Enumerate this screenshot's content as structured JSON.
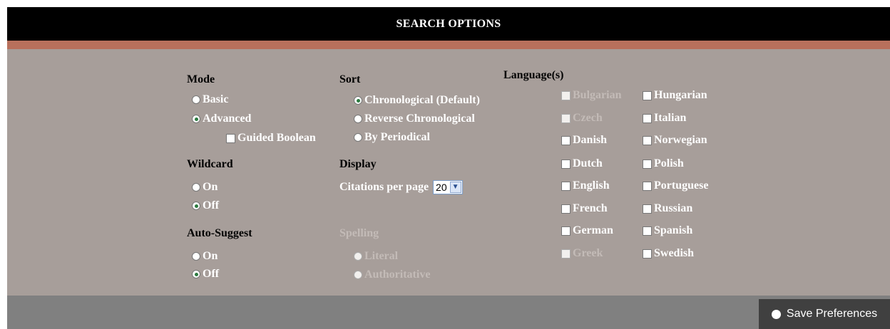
{
  "header": {
    "title": "SEARCH OPTIONS"
  },
  "mode": {
    "label": "Mode",
    "options": [
      {
        "label": "Basic",
        "selected": false
      },
      {
        "label": "Advanced",
        "selected": true
      }
    ],
    "guided_boolean": "Guided Boolean"
  },
  "wildcard": {
    "label": "Wildcard",
    "options": [
      {
        "label": "On",
        "selected": false
      },
      {
        "label": "Off",
        "selected": true
      }
    ]
  },
  "auto_suggest": {
    "label": "Auto-Suggest",
    "options": [
      {
        "label": "On",
        "selected": false
      },
      {
        "label": "Off",
        "selected": true
      }
    ]
  },
  "sort": {
    "label": "Sort",
    "options": [
      {
        "label": "Chronological (Default)",
        "selected": true
      },
      {
        "label": "Reverse Chronological",
        "selected": false
      },
      {
        "label": "By Periodical",
        "selected": false
      }
    ]
  },
  "display": {
    "label": "Display",
    "citations_label": "Citations per page",
    "citations_value": "20"
  },
  "spelling": {
    "label": "Spelling",
    "options": [
      {
        "label": "Literal",
        "selected": false
      },
      {
        "label": "Authoritative",
        "selected": false
      }
    ]
  },
  "languages": {
    "label": "Language(s)",
    "col1": [
      {
        "label": "Bulgarian",
        "disabled": true
      },
      {
        "label": "Czech",
        "disabled": true
      },
      {
        "label": "Danish",
        "disabled": false
      },
      {
        "label": "Dutch",
        "disabled": false
      },
      {
        "label": "English",
        "disabled": false
      },
      {
        "label": "French",
        "disabled": false
      },
      {
        "label": "German",
        "disabled": false
      },
      {
        "label": "Greek",
        "disabled": true
      }
    ],
    "col2": [
      {
        "label": "Hungarian",
        "disabled": false
      },
      {
        "label": "Italian",
        "disabled": false
      },
      {
        "label": "Norwegian",
        "disabled": false
      },
      {
        "label": "Polish",
        "disabled": false
      },
      {
        "label": "Portuguese",
        "disabled": false
      },
      {
        "label": "Russian",
        "disabled": false
      },
      {
        "label": "Spanish",
        "disabled": false
      },
      {
        "label": "Swedish",
        "disabled": false
      }
    ]
  },
  "footer": {
    "save_label": "Save Preferences"
  },
  "colors": {
    "header_bg": "#000000",
    "accent_stripe": "#b8705c",
    "panel_bg": "#a79e9a",
    "footer_bg": "#808080",
    "button_bg": "#404040"
  }
}
